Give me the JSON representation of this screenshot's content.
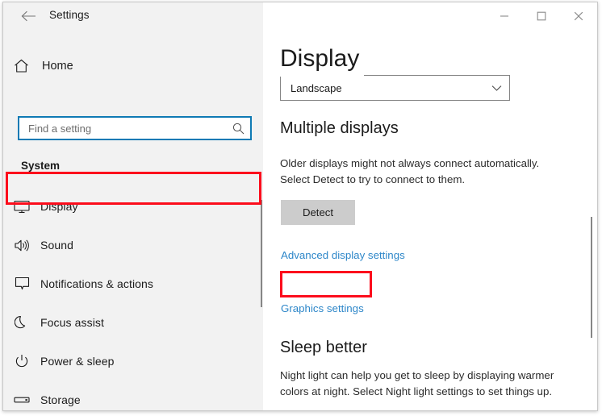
{
  "window": {
    "app_title": "Settings",
    "back_icon": "back-arrow-icon",
    "controls": {
      "minimize": "minimize-icon",
      "maximize": "maximize-icon",
      "close": "close-icon"
    }
  },
  "sidebar": {
    "home_label": "Home",
    "home_icon": "home-icon",
    "search": {
      "placeholder": "Find a setting",
      "value": "",
      "icon": "search-icon"
    },
    "section_label": "System",
    "items": [
      {
        "label": "Display",
        "icon": "monitor-icon",
        "selected": true
      },
      {
        "label": "Sound",
        "icon": "speaker-icon",
        "selected": false
      },
      {
        "label": "Notifications & actions",
        "icon": "notification-balloon-icon",
        "selected": false
      },
      {
        "label": "Focus assist",
        "icon": "moon-icon",
        "selected": false
      },
      {
        "label": "Power & sleep",
        "icon": "power-icon",
        "selected": false
      },
      {
        "label": "Storage",
        "icon": "storage-drive-icon",
        "selected": false
      }
    ]
  },
  "main": {
    "page_title": "Display",
    "orientation_dropdown": {
      "value": "Landscape",
      "chevron_icon": "chevron-down-icon"
    },
    "multiple_displays": {
      "heading": "Multiple displays",
      "description": "Older displays might not always connect automatically. Select Detect to try to connect to them.",
      "detect_label": "Detect"
    },
    "links": [
      {
        "label": "Advanced display settings",
        "highlighted": false
      },
      {
        "label": "Graphics settings",
        "highlighted": true
      }
    ],
    "sleep_better": {
      "heading": "Sleep better",
      "description": "Night light can help you get to sleep by displaying warmer colors at night. Select Night light settings to set things up."
    }
  },
  "annotations": {
    "highlight_color": "#fc0d1c",
    "targets": [
      "Display",
      "Graphics settings"
    ]
  },
  "colors": {
    "accent_blue": "#0f7ab4",
    "link_blue": "#2e87c9",
    "sidebar_bg": "#f2f2f2",
    "button_gray": "#cccccc"
  }
}
